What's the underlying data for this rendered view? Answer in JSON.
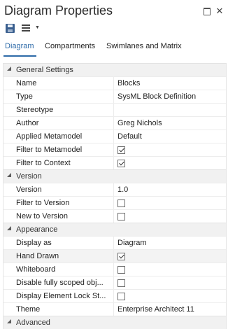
{
  "window": {
    "title": "Diagram Properties"
  },
  "toolbar": {
    "save_icon": "save-icon",
    "menu_icon": "hamburger-menu-icon"
  },
  "tabs": [
    {
      "label": "Diagram",
      "active": true
    },
    {
      "label": "Compartments",
      "active": false
    },
    {
      "label": "Swimlanes and Matrix",
      "active": false
    }
  ],
  "sections": {
    "general": {
      "label": "General Settings",
      "rows": {
        "name": {
          "label": "Name",
          "value": "Blocks"
        },
        "type": {
          "label": "Type",
          "value": "SysML Block Definition"
        },
        "stereotype": {
          "label": "Stereotype",
          "value": ""
        },
        "author": {
          "label": "Author",
          "value": "Greg Nichols"
        },
        "metamodel": {
          "label": "Applied Metamodel",
          "value": "Default"
        },
        "filter_metamodel": {
          "label": "Filter to Metamodel",
          "checked": true
        },
        "filter_context": {
          "label": "Filter to Context",
          "checked": true
        }
      }
    },
    "version": {
      "label": "Version",
      "rows": {
        "version": {
          "label": "Version",
          "value": "1.0"
        },
        "filter_version": {
          "label": "Filter to Version",
          "checked": false
        },
        "new_version": {
          "label": "New to Version",
          "checked": false
        }
      }
    },
    "appearance": {
      "label": "Appearance",
      "rows": {
        "display_as": {
          "label": "Display as",
          "value": "Diagram"
        },
        "hand_drawn": {
          "label": "Hand Drawn",
          "checked": true
        },
        "whiteboard": {
          "label": "Whiteboard",
          "checked": false
        },
        "disable_scoped": {
          "label": "Disable fully scoped obj...",
          "checked": false
        },
        "display_lock": {
          "label": "Display Element Lock St...",
          "checked": false
        },
        "theme": {
          "label": "Theme",
          "value": "Enterprise Architect 11"
        }
      }
    },
    "advanced": {
      "label": "Advanced"
    }
  }
}
